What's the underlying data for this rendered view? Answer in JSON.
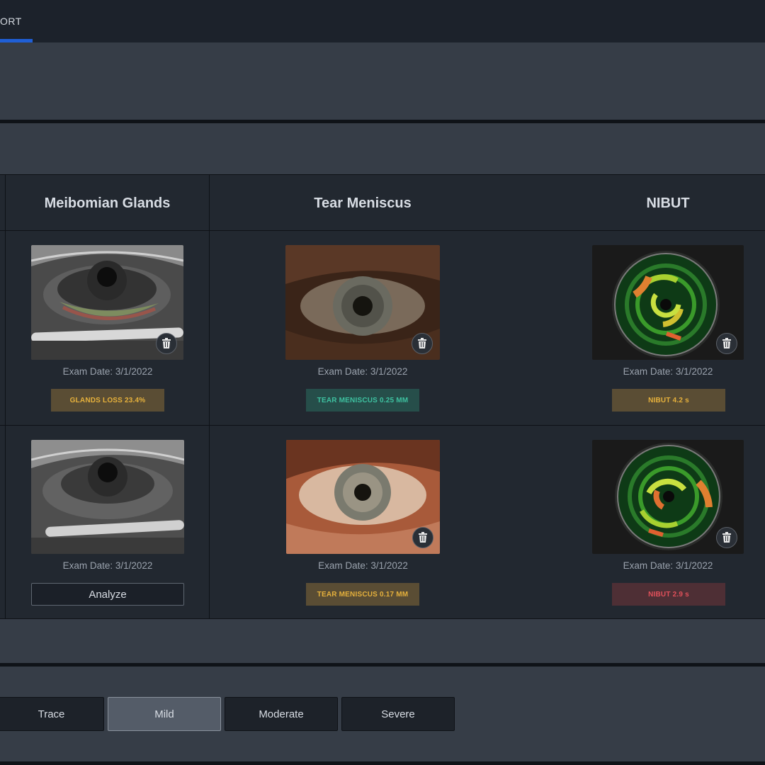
{
  "tab": {
    "label": "ORT"
  },
  "columns": {
    "meibomian": "Meibomian Glands",
    "tear": "Tear Meniscus",
    "nibut": "NIBUT"
  },
  "rows": [
    {
      "meibomian": {
        "exam": "Exam Date: 3/1/2022",
        "badge": "GLANDS LOSS 23.4%"
      },
      "tear": {
        "exam": "Exam Date: 3/1/2022",
        "badge": "TEAR MENISCUS 0.25 MM"
      },
      "nibut": {
        "exam": "Exam Date: 3/1/2022",
        "badge": "NIBUT 4.2 s"
      }
    },
    {
      "meibomian": {
        "exam": "Exam Date: 3/1/2022",
        "action": "Analyze"
      },
      "tear": {
        "exam": "Exam Date: 3/1/2022",
        "badge": "TEAR MENISCUS 0.17 MM"
      },
      "nibut": {
        "exam": "Exam Date: 3/1/2022",
        "badge": "NIBUT 2.9 s"
      }
    }
  ],
  "severity": {
    "options": [
      "Trace",
      "Mild",
      "Moderate",
      "Severe"
    ],
    "selected": "Mild"
  },
  "icons": {
    "delete": "trash-icon"
  },
  "colors": {
    "tab_accent": "#1f5fd6",
    "amber": "#e6b13c",
    "teal": "#3ec1a0",
    "red": "#e0505a"
  }
}
